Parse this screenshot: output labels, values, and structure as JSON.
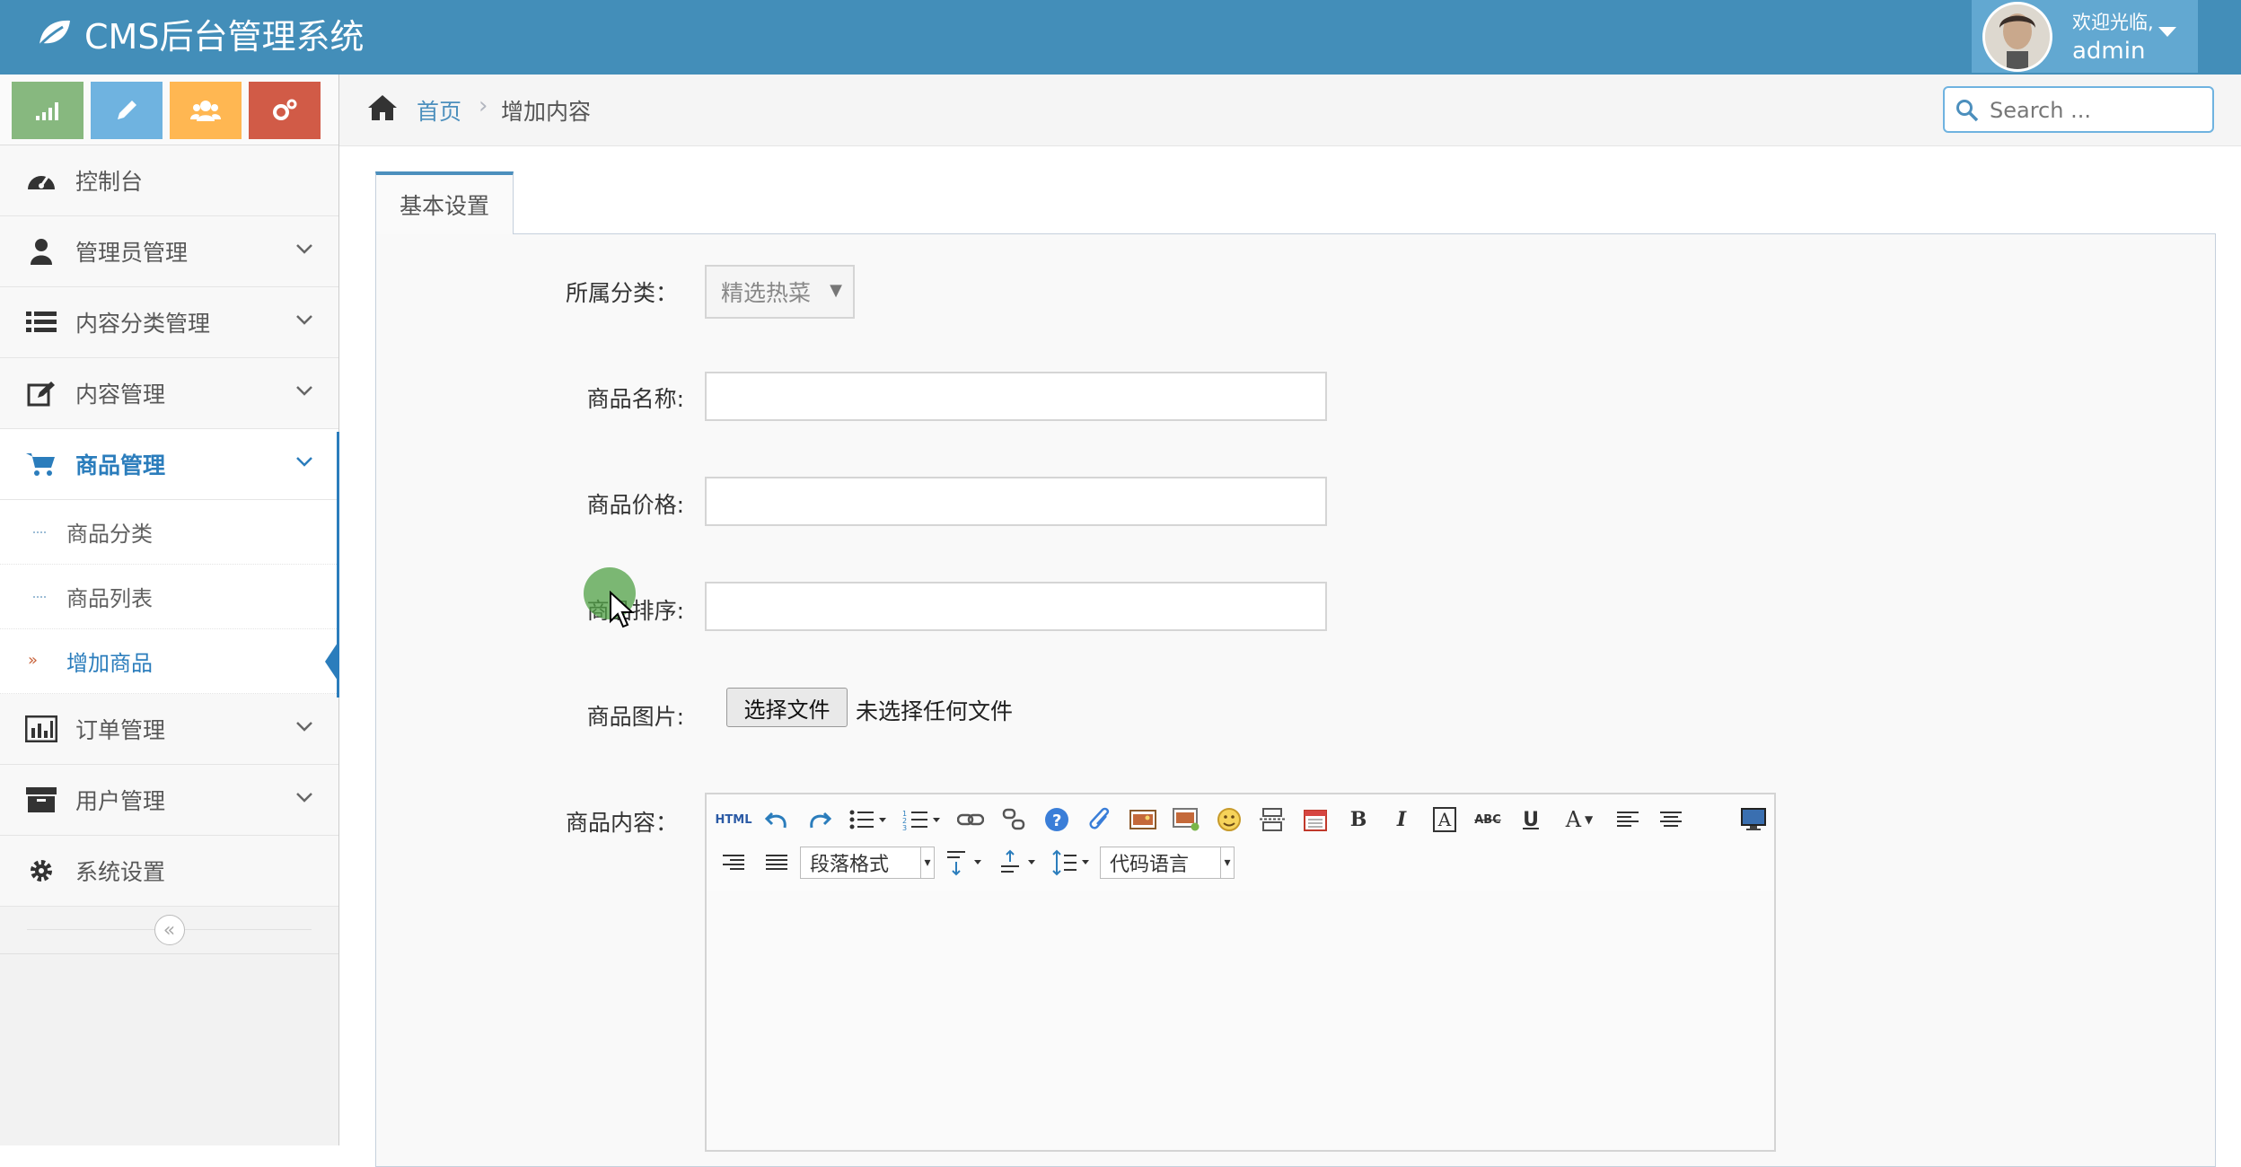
{
  "app": {
    "title": "CMS后台管理系统"
  },
  "user": {
    "greeting": "欢迎光临,",
    "name": "admin"
  },
  "shortcuts": [
    {
      "icon": "signal-icon",
      "color": "#87b87f"
    },
    {
      "icon": "pencil-icon",
      "color": "#6fb3e0"
    },
    {
      "icon": "users-icon",
      "color": "#ffb752"
    },
    {
      "icon": "cogs-icon",
      "color": "#d15b47"
    }
  ],
  "sidebar": {
    "items": [
      {
        "label": "控制台",
        "icon": "dashboard-icon"
      },
      {
        "label": "管理员管理",
        "icon": "user-admin-icon"
      },
      {
        "label": "内容分类管理",
        "icon": "list-icon"
      },
      {
        "label": "内容管理",
        "icon": "edit-icon"
      },
      {
        "label": "商品管理",
        "icon": "cart-icon",
        "active": true
      },
      {
        "label": "订单管理",
        "icon": "bar-chart-icon"
      },
      {
        "label": "用户管理",
        "icon": "archive-icon"
      },
      {
        "label": "系统设置",
        "icon": "gear-icon"
      }
    ],
    "submenu": [
      {
        "label": "商品分类"
      },
      {
        "label": "商品列表"
      },
      {
        "label": "增加商品",
        "active": true
      }
    ],
    "collapse_icon": "double-chevron-left-icon"
  },
  "breadcrumb": {
    "home": "首页",
    "current": "增加内容"
  },
  "search": {
    "placeholder": "Search ..."
  },
  "tabs": [
    {
      "label": "基本设置",
      "active": true
    }
  ],
  "form": {
    "category_label": "所属分类：",
    "category_value": "精选热菜",
    "name_label": "商品名称:",
    "price_label": "商品价格:",
    "sort_label": "商品排序:",
    "image_label": "商品图片:",
    "file_button": "选择文件",
    "file_status": "未选择任何文件",
    "content_label": "商品内容："
  },
  "editor": {
    "html_label": "HTML",
    "bold": "B",
    "italic": "I",
    "underline": "U",
    "strike": "ABC",
    "font_color": "A",
    "paragraph_format": "段落格式",
    "code_language": "代码语言"
  },
  "colors": {
    "navbar": "#438eb9",
    "user_box": "#62a8d1",
    "accent": "#2b7dbc"
  }
}
